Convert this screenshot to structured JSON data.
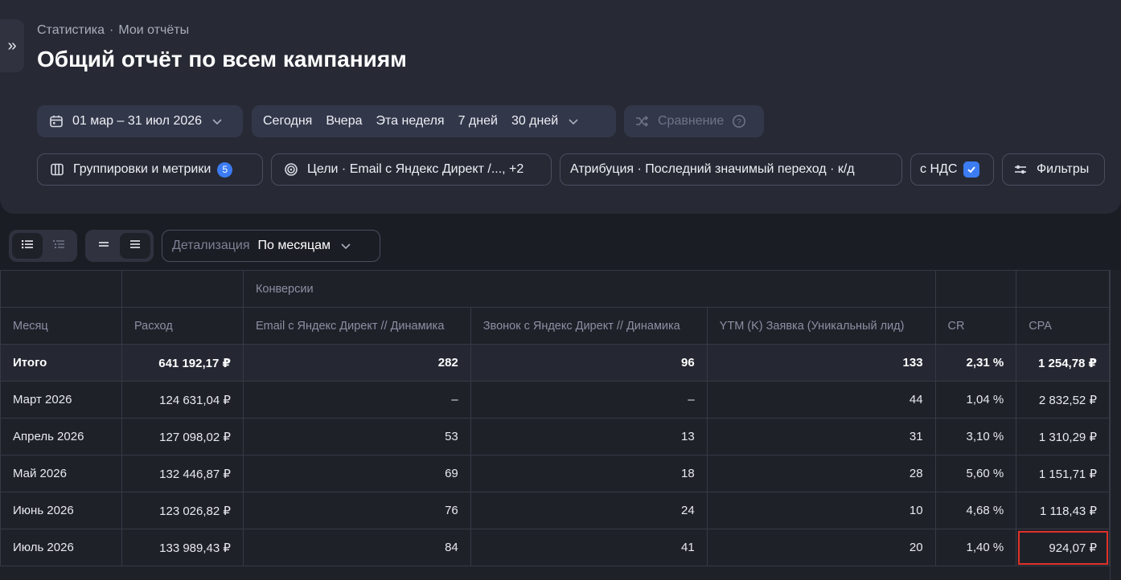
{
  "breadcrumb": {
    "root": "Статистика",
    "separator": "·",
    "current": "Мои отчёты"
  },
  "page_title": "Общий отчёт по всем кампаниям",
  "date_range": {
    "label": "01 мар – 31 июл 2026"
  },
  "quick_periods": [
    "Сегодня",
    "Вчера",
    "Эта неделя",
    "7 дней",
    "30 дней"
  ],
  "compare": {
    "label": "Сравнение"
  },
  "groupings": {
    "label": "Группировки и метрики",
    "badge": "5"
  },
  "goals": {
    "label": "Цели · Email с Яндекс Директ /..., +2"
  },
  "attribution": {
    "label": "Атрибуция · Последний значимый переход · к/д"
  },
  "vat": {
    "label": "с НДС",
    "checked": true
  },
  "filters": {
    "label": "Фильтры"
  },
  "detail": {
    "label": "Детализация",
    "value": "По месяцам"
  },
  "table": {
    "group_header": "Конверсии",
    "columns": [
      "Месяц",
      "Расход",
      "Email с Яндекс Директ // Динамика",
      "Звонок с Яндекс Директ // Динамика",
      "YTM (K) Заявка (Уникальный лид)",
      "CR",
      "CPA"
    ],
    "total": [
      "Итого",
      "641 192,17 ₽",
      "282",
      "96",
      "133",
      "2,31 %",
      "1 254,78 ₽"
    ],
    "rows": [
      [
        "Март 2026",
        "124 631,04 ₽",
        "–",
        "–",
        "44",
        "1,04 %",
        "2 832,52 ₽"
      ],
      [
        "Апрель 2026",
        "127 098,02 ₽",
        "53",
        "13",
        "31",
        "3,10 %",
        "1 310,29 ₽"
      ],
      [
        "Май 2026",
        "132 446,87 ₽",
        "69",
        "18",
        "28",
        "5,60 %",
        "1 151,71 ₽"
      ],
      [
        "Июнь 2026",
        "123 026,82 ₽",
        "76",
        "24",
        "10",
        "4,68 %",
        "1 118,43 ₽"
      ],
      [
        "Июль 2026",
        "133 989,43 ₽",
        "84",
        "41",
        "20",
        "1,40 %",
        "924,07 ₽"
      ]
    ]
  },
  "colors": {
    "accent": "#3c7cf3",
    "highlight": "#e0312a",
    "panel": "#272a35",
    "background": "#1b1d24"
  }
}
